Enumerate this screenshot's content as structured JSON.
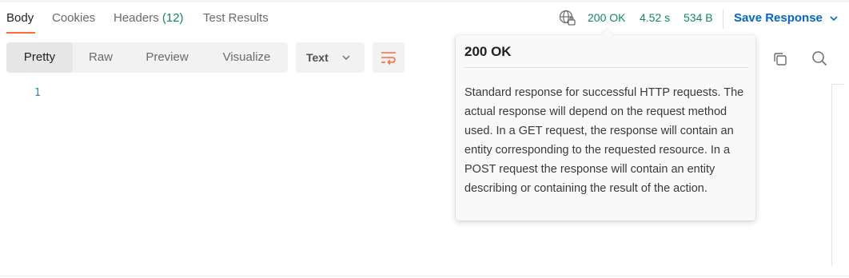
{
  "tabs": [
    {
      "label": "Body"
    },
    {
      "label": "Cookies"
    },
    {
      "label": "Headers",
      "count": "(12)"
    },
    {
      "label": "Test Results"
    }
  ],
  "response": {
    "status": "200 OK",
    "time": "4.52 s",
    "size": "534 B",
    "globe_icon": "globe-lock-icon"
  },
  "save": {
    "label": "Save Response",
    "icon": "chevron-down-icon"
  },
  "view_modes": [
    "Pretty",
    "Raw",
    "Preview",
    "Visualize"
  ],
  "format": {
    "selected": "Text",
    "icon": "chevron-down-icon"
  },
  "toolbar_icons": [
    "wrap-lines-icon",
    "copy-icon",
    "search-icon"
  ],
  "editor": {
    "line_numbers": [
      "1"
    ]
  },
  "tooltip": {
    "title": "200 OK",
    "description": "Standard response for successful HTTP requests. The actual response will depend on the request method used. In a GET request, the response will contain an entity corresponding to the requested resource. In a POST request the response will contain an entity describing or containing the result of the action."
  },
  "colors": {
    "accent": "#ff6c37",
    "success": "#0f8a5f",
    "link": "#0265d2",
    "line_number": "#2d8aa0"
  }
}
